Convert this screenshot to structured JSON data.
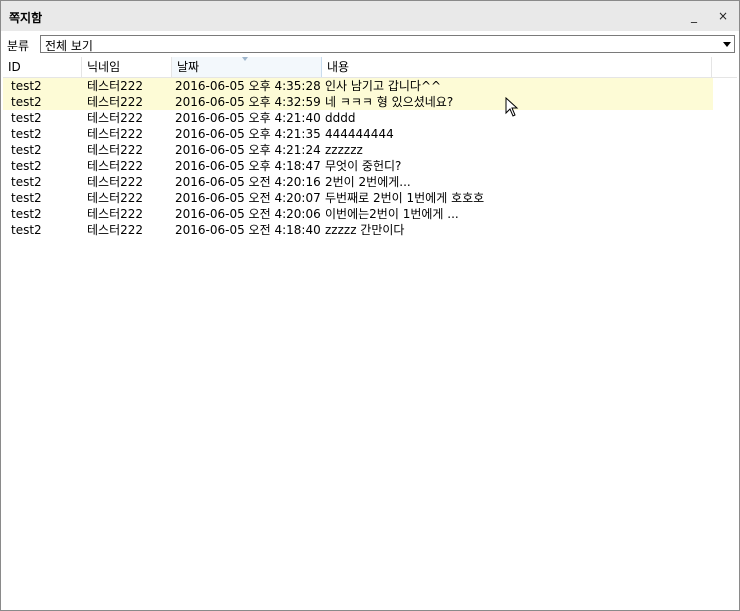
{
  "window": {
    "title": "쪽지함",
    "minimize_glyph": "_",
    "close_glyph": "×"
  },
  "filter": {
    "label": "분류",
    "selected": "전체 보기"
  },
  "table": {
    "columns": [
      "ID",
      "닉네임",
      "날짜",
      "내용"
    ],
    "sorted_column": "날짜",
    "sort_direction": "descending",
    "rows": [
      {
        "id": "test2",
        "nick": "테스터222",
        "date": "2016-06-05 오후 4:35:28",
        "content": "인사 남기고 갑니다^^",
        "unread": true
      },
      {
        "id": "test2",
        "nick": "테스터222",
        "date": "2016-06-05 오후 4:32:59",
        "content": "네 ㅋㅋㅋ 형 있으셨네요?",
        "unread": true
      },
      {
        "id": "test2",
        "nick": "테스터222",
        "date": "2016-06-05 오후 4:21:40",
        "content": "dddd",
        "unread": false
      },
      {
        "id": "test2",
        "nick": "테스터222",
        "date": "2016-06-05 오후 4:21:35",
        "content": "444444444",
        "unread": false
      },
      {
        "id": "test2",
        "nick": "테스터222",
        "date": "2016-06-05 오후 4:21:24",
        "content": "zzzzzz",
        "unread": false
      },
      {
        "id": "test2",
        "nick": "테스터222",
        "date": "2016-06-05 오후 4:18:47",
        "content": "무엇이 중헌디?",
        "unread": false
      },
      {
        "id": "test2",
        "nick": "테스터222",
        "date": "2016-06-05 오전 4:20:16",
        "content": "2번이 2번에게...",
        "unread": false
      },
      {
        "id": "test2",
        "nick": "테스터222",
        "date": "2016-06-05 오전 4:20:07",
        "content": "두번째로 2번이 1번에게 호호호",
        "unread": false
      },
      {
        "id": "test2",
        "nick": "테스터222",
        "date": "2016-06-05 오전 4:20:06",
        "content": "이번에는2번이 1번에게 ...",
        "unread": false
      },
      {
        "id": "test2",
        "nick": "테스터222",
        "date": "2016-06-05 오전 4:18:40",
        "content": "zzzzz 간만이다",
        "unread": false
      }
    ]
  },
  "colors": {
    "unread_highlight": "#fdfbd6",
    "titlebar": "#e9e9e9",
    "sorted_header": "#f3f8fc"
  }
}
